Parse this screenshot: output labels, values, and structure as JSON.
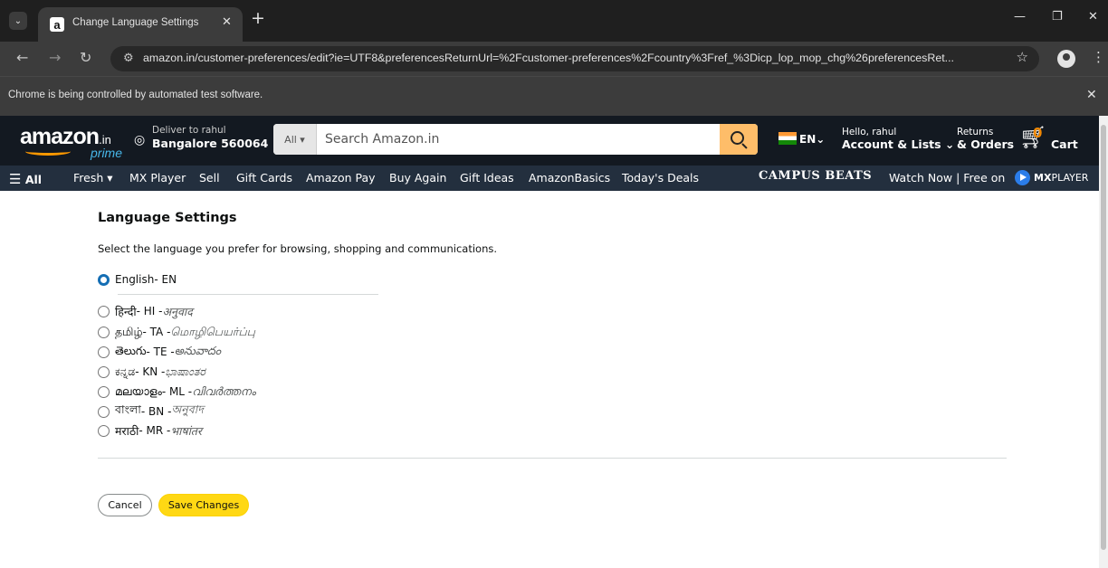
{
  "browser": {
    "tab_search_glyph": "⌄",
    "tab_title": "Change Language Settings",
    "tab_favicon": "a",
    "tab_close": "✕",
    "new_tab": "+",
    "win_min": "—",
    "win_restore": "❐",
    "win_close": "✕",
    "back": "←",
    "forward": "→",
    "reload": "↻",
    "url": "amazon.in/customer-preferences/edit?ie=UTF8&preferencesReturnUrl=%2Fcustomer-preferences%2Fcountry%3Fref_%3Dicp_lop_mop_chg%26preferencesRet...",
    "bookmark_star": "☆",
    "menu": "⋮",
    "infobar_text": "Chrome is being controlled by automated test software.",
    "infobar_close": "✕"
  },
  "header": {
    "logo_text": "amazon",
    "logo_suffix": ".in",
    "logo_prime": "prime",
    "deliver_line1": "Deliver to rahul",
    "deliver_line2": "Bangalore 560064",
    "search_category": "All ▾",
    "search_placeholder": "Search Amazon.in",
    "language": "EN",
    "language_caret": "⌄",
    "account_line1": "Hello, rahul",
    "account_line2": "Account & Lists ⌄",
    "returns_line1": "Returns",
    "returns_line2": "& Orders",
    "cart_count": "0",
    "cart_label": "Cart"
  },
  "subnav": {
    "all_label": "All",
    "items": [
      "Fresh ▾",
      "MX Player",
      "Sell",
      "Gift Cards",
      "Amazon Pay",
      "Buy Again",
      "Gift Ideas",
      "AmazonBasics",
      "Today's Deals"
    ],
    "promo_brand": "CAMPUS BEATS",
    "promo_text": "Watch Now | Free on",
    "promo_logo_bold": "MX",
    "promo_logo_rest": "PLAYER"
  },
  "settings": {
    "title": "Language Settings",
    "description": "Select the language you prefer for browsing, shopping and communications.",
    "options": [
      {
        "native": "English",
        "code": " - EN",
        "translation": "",
        "selected": true
      },
      {
        "native": "हिन्दी",
        "code": " - HI - ",
        "translation": "अनुवाद",
        "selected": false
      },
      {
        "native": "தமிழ்",
        "code": " - TA - ",
        "translation": "மொழிபெயர்ப்பு",
        "selected": false
      },
      {
        "native": "తెలుగు",
        "code": " - TE - ",
        "translation": "అనువాదం",
        "selected": false
      },
      {
        "native": "ಕನ್ನಡ",
        "code": " - KN - ",
        "translation": "ಭಾಷಾಂತರ",
        "selected": false
      },
      {
        "native": "മലയാളം",
        "code": " - ML - ",
        "translation": "വിവർത്തനം",
        "selected": false
      },
      {
        "native": "বাংলা",
        "code": " - BN - ",
        "translation": "অনুবাদ",
        "selected": false
      },
      {
        "native": "मराठी",
        "code": " - MR - ",
        "translation": "भाषांतर",
        "selected": false
      }
    ],
    "cancel_label": "Cancel",
    "save_label": "Save Changes"
  },
  "colors": {
    "accent_blue": "#146eb4",
    "save_yellow": "#ffd814",
    "amazon_dark": "#131921",
    "amazon_nav": "#232f3e",
    "search_orange": "#febd69"
  }
}
